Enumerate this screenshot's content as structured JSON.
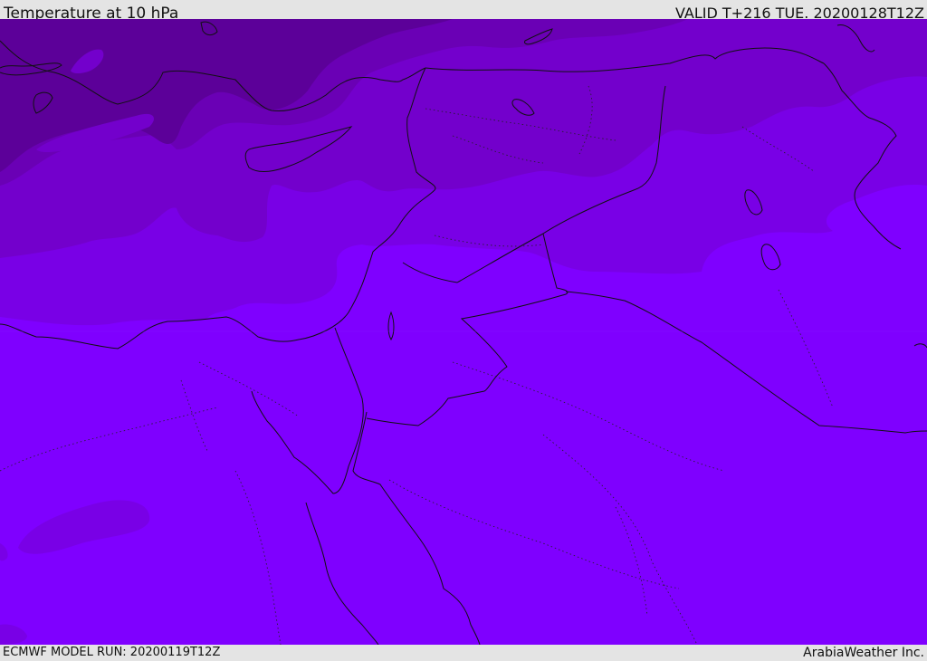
{
  "header": {
    "title": "Temperature at 10 hPa",
    "valid": "VALID T+216 TUE. 20200128T12Z"
  },
  "footer": {
    "model_run": "ECMWF MODEL RUN: 20200119T12Z",
    "credit": "ArabiaWeather Inc."
  },
  "map": {
    "region": "Eastern Mediterranean / Levant / Arabian Peninsula",
    "colors": {
      "band_darkest": "#5c0099",
      "band_dark": "#6a00b5",
      "band_mid": "#7300cc",
      "band_light": "#7900e6",
      "base": "#7f00ff",
      "coastline": "#111111"
    }
  }
}
